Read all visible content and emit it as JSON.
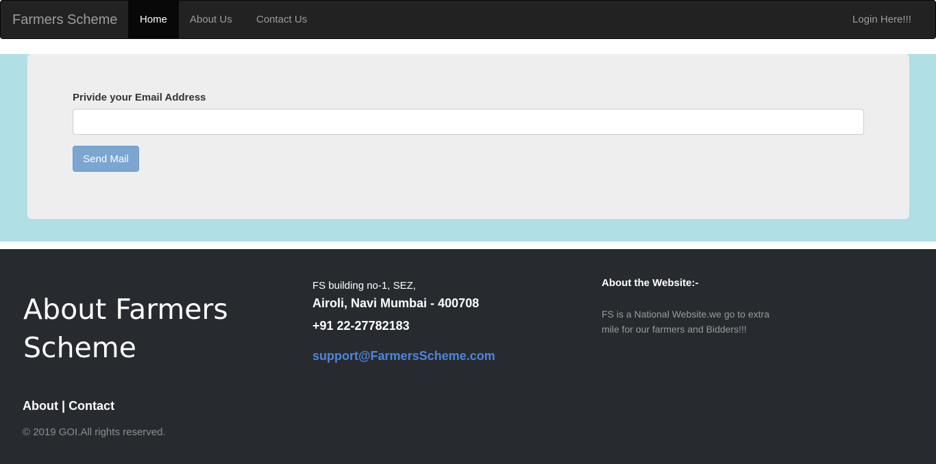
{
  "navbar": {
    "brand": "Farmers Scheme",
    "items": [
      {
        "label": "Home",
        "active": true
      },
      {
        "label": "About Us",
        "active": false
      },
      {
        "label": "Contact Us",
        "active": false
      }
    ],
    "login_label": "Login Here!!!"
  },
  "form": {
    "email_label": "Privide your Email Address",
    "email_value": "",
    "email_placeholder": "",
    "send_label": "Send Mail"
  },
  "footer": {
    "about_title": "About Farmers Scheme",
    "links": {
      "about": "About",
      "separator": "|",
      "contact": "Contact"
    },
    "copyright": "© 2019 GOI.All rights reserved.",
    "address_line1": "FS building no-1, SEZ,",
    "address_line2": "Airoli, Navi Mumbai - 400708",
    "phone": "+91 22-27782183",
    "email": "support@FarmersScheme.com",
    "website_title": "About the Website:-",
    "website_desc": "FS is a National Website.we go to extra mile for our farmers and Bidders!!!"
  },
  "colors": {
    "navbar_bg": "#222222",
    "band_bg": "#b0e0e6",
    "panel_bg": "#eeeeee",
    "button_bg": "#7aa6d0",
    "footer_bg": "#272b30",
    "link_accent": "#4f86d9"
  }
}
